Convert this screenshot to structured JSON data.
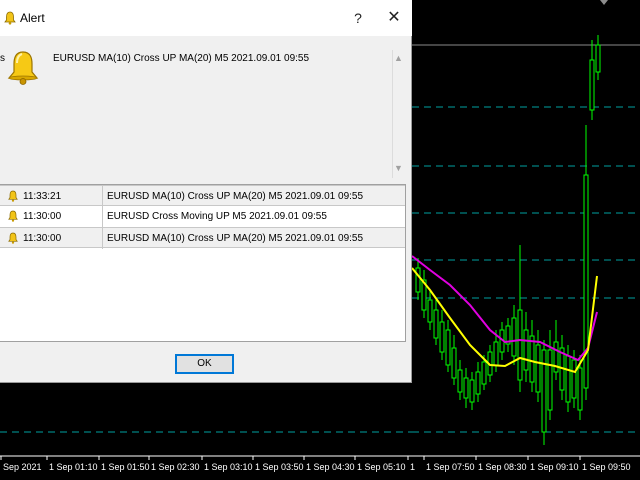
{
  "dialog": {
    "title": "Alert",
    "help_label": "?",
    "close_label": "✕",
    "message": "EURUSD MA(10) Cross UP MA(20)  M5  2021.09.01 09:55",
    "left_edge_fragment": "s",
    "ok_label": "OK",
    "alerts": [
      {
        "time": "11:33:21",
        "message": "EURUSD MA(10) Cross UP MA(20)  M5  2021.09.01 09:55"
      },
      {
        "time": "11:30:00",
        "message": "EURUSD Cross Moving UP  M5  2021.09.01 09:55"
      },
      {
        "time": "11:30:00",
        "message": "EURUSD MA(10) Cross UP MA(20)  M5  2021.09.01 09:55"
      }
    ]
  },
  "chart": {
    "colors": {
      "background": "#000000",
      "candles": "#00ff00",
      "ma_fast": "#ffff00",
      "ma_slow": "#e000e0",
      "levels": "#00a0a0",
      "top_line": "#8a8a8a",
      "axis_text": "#ffffff"
    },
    "time_labels": [
      "Sep 2021",
      "1 Sep 01:10",
      "1 Sep 01:50",
      "1 Sep 02:30",
      "1 Sep 03:10",
      "1 Sep 03:50",
      "1 Sep 04:30",
      "1 Sep 05:10",
      "1",
      "1 Sep 07:50",
      "1 Sep 08:30",
      "1 Sep 09:10",
      "1 Sep 09:50"
    ]
  }
}
